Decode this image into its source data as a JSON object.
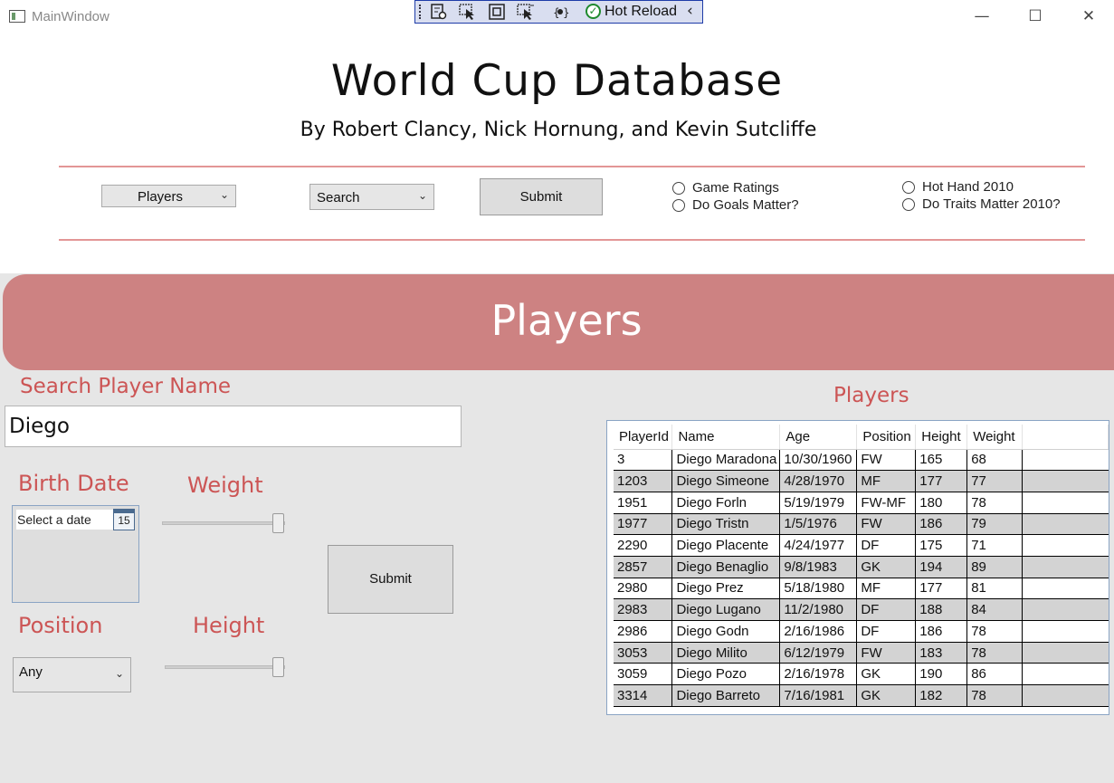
{
  "window": {
    "title": "MainWindow",
    "controls": {
      "minimize": "—",
      "maximize": "☐",
      "close": "✕"
    }
  },
  "debug_toolbar": {
    "label": "Hot Reload",
    "icons": [
      "live-visual-tree-icon",
      "select-element-icon",
      "display-layout-adorners-icon",
      "track-focus-icon",
      "binding-failures-icon",
      "hot-reload-status-icon",
      "collapse-toolbar-icon"
    ]
  },
  "header": {
    "title": "World Cup Database",
    "subtitle": "By Robert Clancy, Nick Hornung, and Kevin Sutcliffe",
    "table_select": "Players",
    "mode_select": "Search",
    "submit": "Submit",
    "radios": [
      "Game Ratings",
      "Do Goals Matter?",
      "Hot Hand 2010",
      "Do Traits Matter 2010?"
    ]
  },
  "banner": {
    "title": "Players"
  },
  "filters": {
    "name_label": "Search Player Name",
    "name_value": "Diego",
    "birth_label": "Birth Date",
    "birth_placeholder": "Select a date",
    "calendar_day": "15",
    "weight_label": "Weight",
    "weight_level": 1.0,
    "position_label": "Position",
    "position_value": "Any",
    "height_label": "Height",
    "height_level": 1.0,
    "submit": "Submit"
  },
  "grid": {
    "title": "Players",
    "columns": [
      "PlayerId",
      "Name",
      "Age",
      "Position",
      "Height",
      "Weight"
    ],
    "rows": [
      [
        "3",
        "Diego Maradona",
        "10/30/1960",
        "FW",
        "165",
        "68"
      ],
      [
        "1203",
        "Diego Simeone",
        "4/28/1970",
        "MF",
        "177",
        "77"
      ],
      [
        "1951",
        "Diego Forln",
        "5/19/1979",
        "FW-MF",
        "180",
        "78"
      ],
      [
        "1977",
        "Diego Tristn",
        "1/5/1976",
        "FW",
        "186",
        "79"
      ],
      [
        "2290",
        "Diego Placente",
        "4/24/1977",
        "DF",
        "175",
        "71"
      ],
      [
        "2857",
        "Diego Benaglio",
        "9/8/1983",
        "GK",
        "194",
        "89"
      ],
      [
        "2980",
        "Diego Prez",
        "5/18/1980",
        "MF",
        "177",
        "81"
      ],
      [
        "2983",
        "Diego Lugano",
        "11/2/1980",
        "DF",
        "188",
        "84"
      ],
      [
        "2986",
        "Diego Godn",
        "2/16/1986",
        "DF",
        "186",
        "78"
      ],
      [
        "3053",
        "Diego Milito",
        "6/12/1979",
        "FW",
        "183",
        "78"
      ],
      [
        "3059",
        "Diego Pozo",
        "2/16/1978",
        "GK",
        "190",
        "86"
      ],
      [
        "3314",
        "Diego Barreto",
        "7/16/1981",
        "GK",
        "182",
        "78"
      ]
    ]
  },
  "colors": {
    "accent": "#cc5555",
    "banner": "#cd8282",
    "rule": "#e39696",
    "panel": "#e6e6e6",
    "alt_row": "#d3d3d3",
    "hot_reload_ok": "#1f8a2e"
  }
}
